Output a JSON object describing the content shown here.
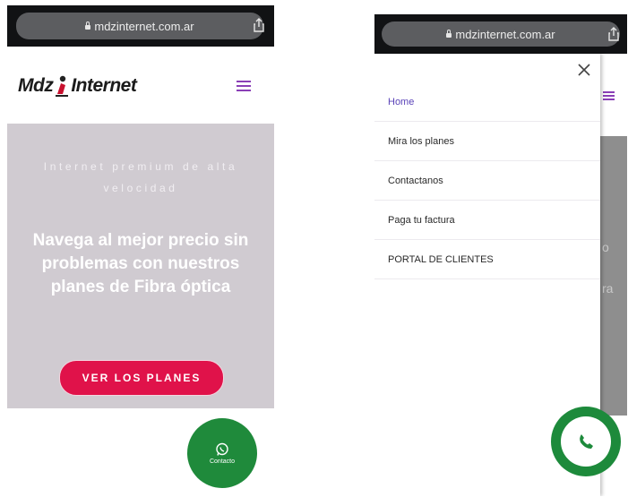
{
  "left_screen": {
    "browser": {
      "url": "mdzinternet.com.ar"
    },
    "header": {
      "logo_text_left": "Mdz",
      "logo_text_right": "Internet"
    },
    "hero": {
      "tagline": "Internet premium de alta velocidad",
      "headline": "Navega al mejor precio sin problemas con nuestros planes de Fibra óptica",
      "cta_label": "VER LOS PLANES"
    },
    "fab": {
      "label": "Contacto",
      "icon": "whatsapp-icon"
    }
  },
  "right_screen": {
    "browser": {
      "url": "mdzinternet.com.ar"
    },
    "menu": {
      "items": [
        {
          "label": "Home",
          "active": true
        },
        {
          "label": "Mira los planes",
          "active": false
        },
        {
          "label": "Contactanos",
          "active": false
        },
        {
          "label": "Paga tu factura",
          "active": false
        },
        {
          "label": "PORTAL DE CLIENTES",
          "active": false
        }
      ]
    },
    "background_hints": [
      "o",
      "ra"
    ],
    "fab": {
      "icon": "phone-icon"
    }
  },
  "colors": {
    "accent": "#8a3fb6",
    "cta": "#e0124a",
    "hero_bg": "#d0cbd1",
    "fab_green": "#1f8a3b",
    "active_menu": "#5a43b8"
  }
}
